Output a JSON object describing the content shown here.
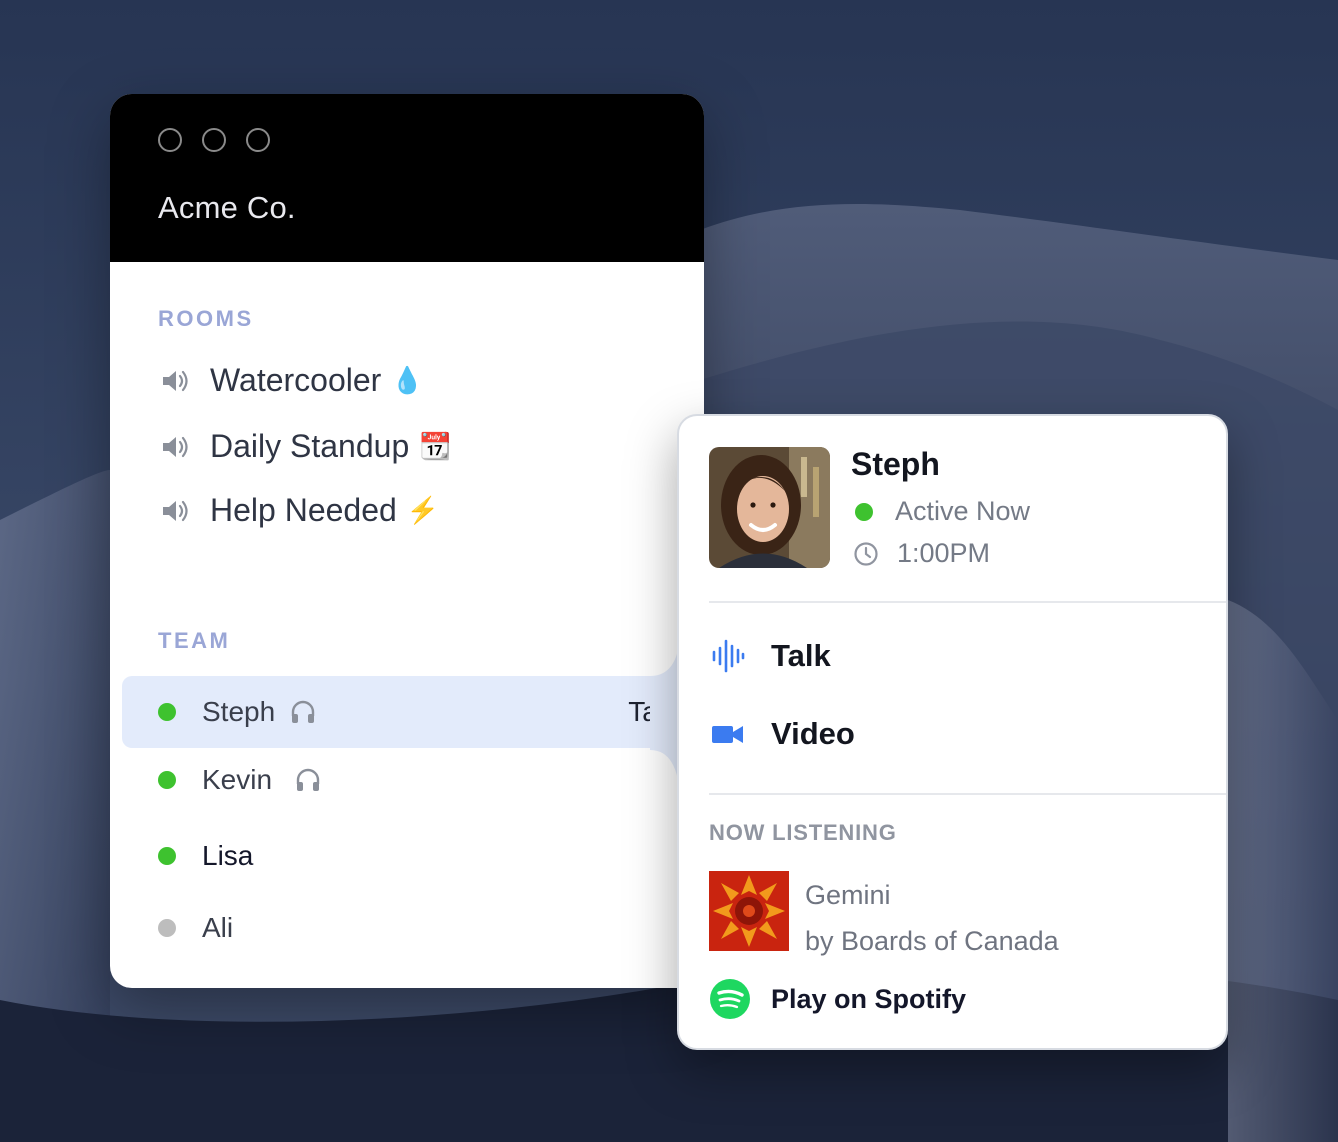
{
  "window": {
    "title": "Acme Co."
  },
  "rooms": {
    "heading": "ROOMS",
    "items": [
      {
        "label": "Watercooler",
        "emoji": "💧"
      },
      {
        "label": "Daily Standup",
        "emoji": "📆"
      },
      {
        "label": "Help Needed",
        "emoji": "⚡"
      }
    ]
  },
  "team": {
    "heading": "TEAM",
    "members": [
      {
        "name": "Steph",
        "status": "online",
        "listening": true,
        "selected": true,
        "action": "Talk"
      },
      {
        "name": "Kevin",
        "status": "online",
        "listening": true
      },
      {
        "name": "Lisa",
        "status": "online",
        "listening": false
      },
      {
        "name": "Ali",
        "status": "offline",
        "listening": false
      }
    ]
  },
  "popover": {
    "name": "Steph",
    "status": "Active Now",
    "local_time": "1:00PM",
    "actions": [
      {
        "label": "Talk",
        "icon": "audio-waveform-icon"
      },
      {
        "label": "Video",
        "icon": "video-camera-icon"
      }
    ],
    "now_listening": {
      "heading": "NOW LISTENING",
      "track": "Gemini",
      "artist": "by Boards of Canada",
      "cta": "Play on Spotify"
    }
  },
  "colors": {
    "accent_blue": "#3b7bf0",
    "online_green": "#3ec22f",
    "offline_gray": "#bdbdbd",
    "section_label": "#9aa6d6",
    "spotify_green": "#1ed760",
    "selected_row": "#e3ebfb"
  }
}
